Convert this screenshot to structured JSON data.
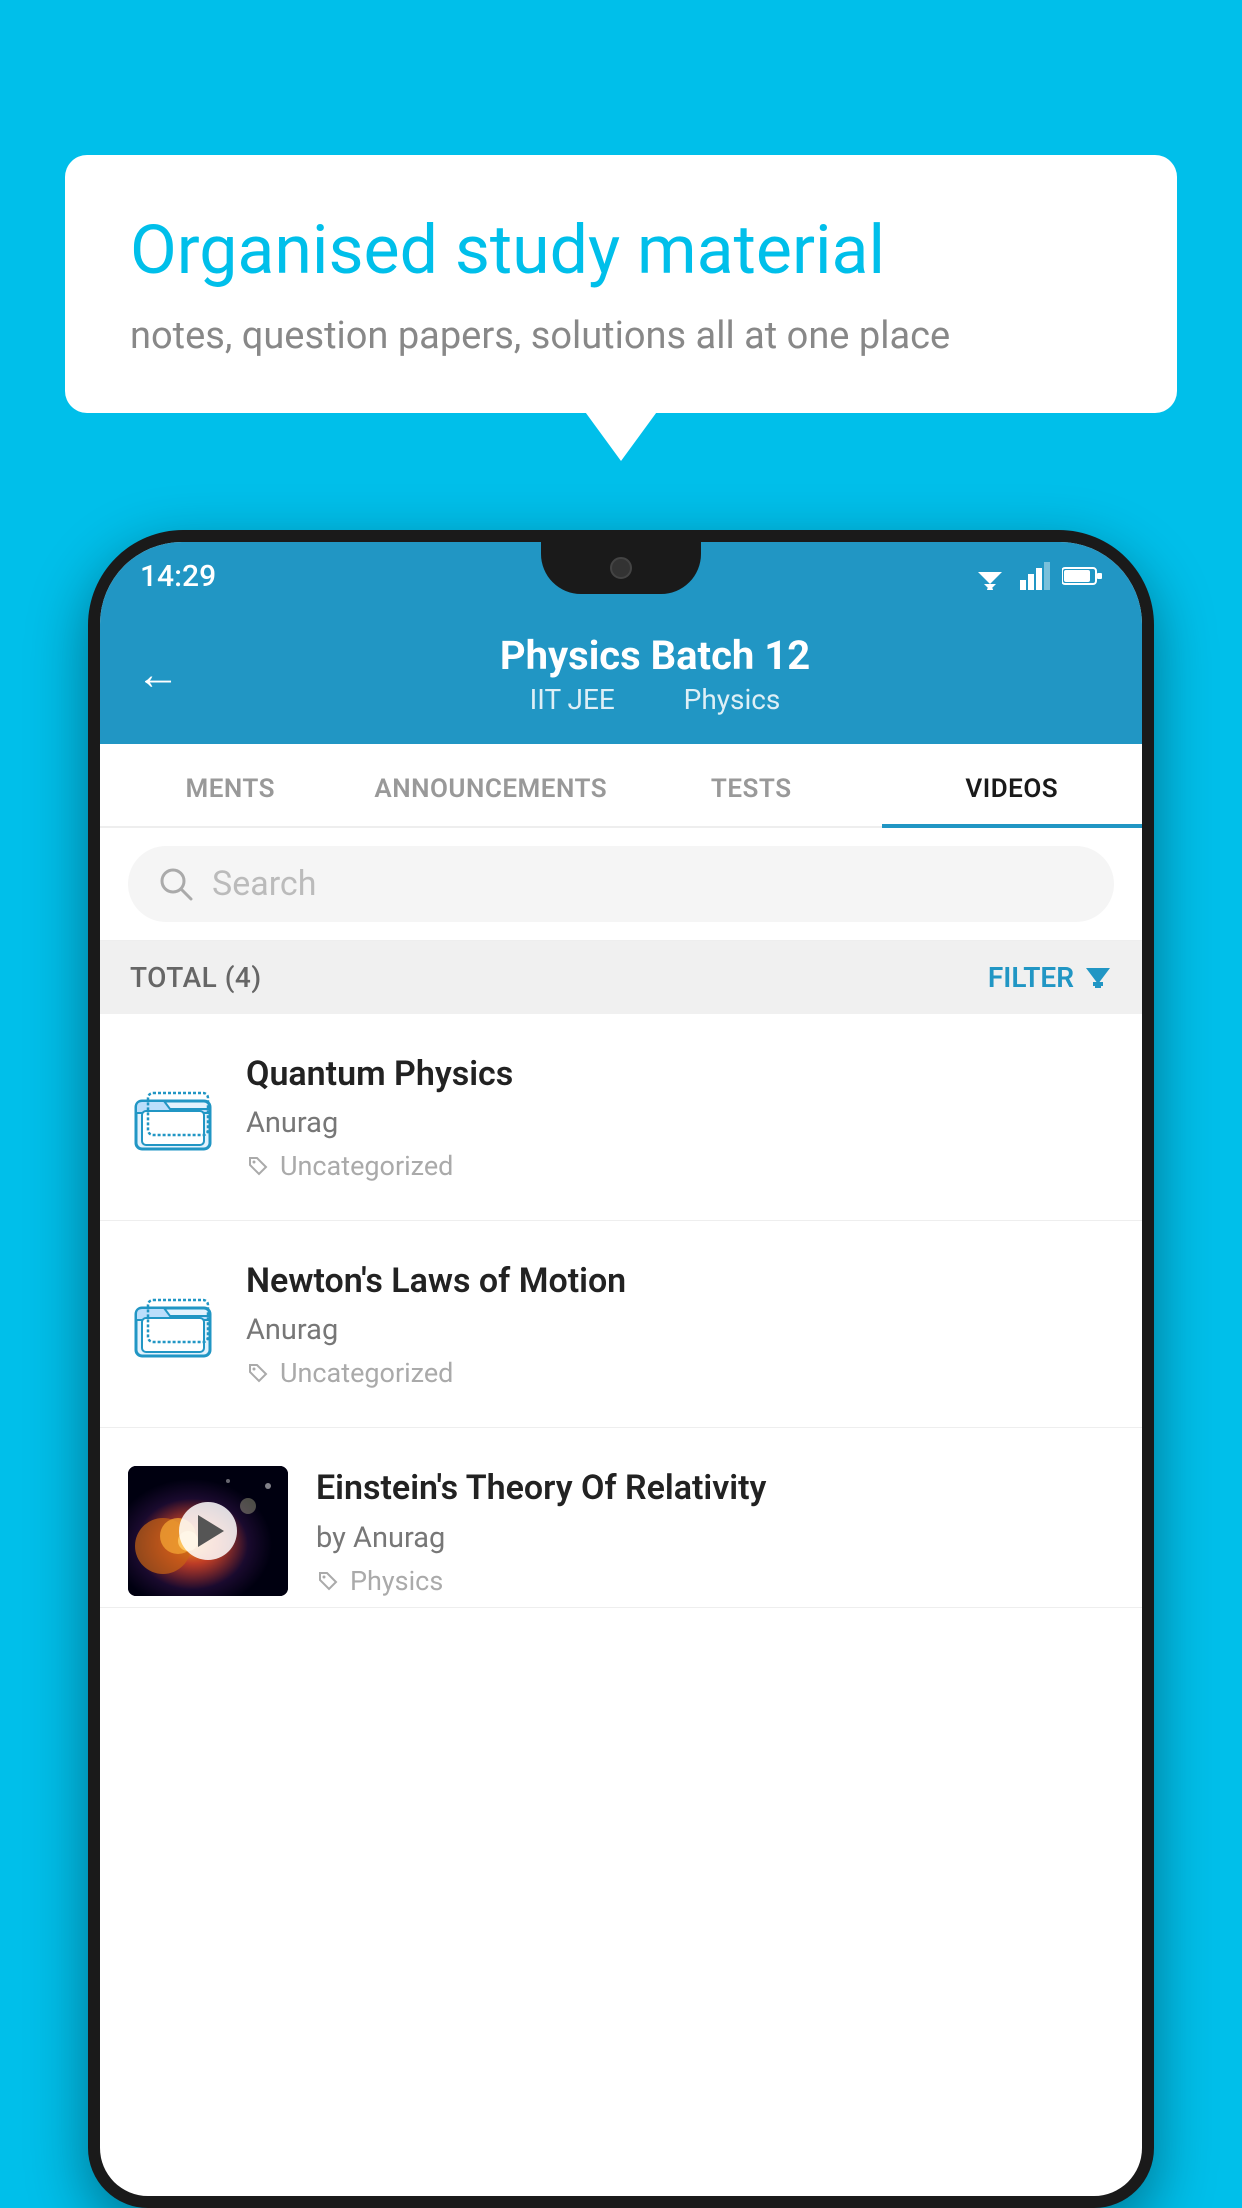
{
  "background_color": "#00BFEA",
  "speech_bubble": {
    "heading": "Organised study material",
    "subtext": "notes, question papers, solutions all at one place"
  },
  "status_bar": {
    "time": "14:29",
    "wifi_icon": "wifi-icon",
    "signal_icon": "signal-icon",
    "battery_icon": "battery-icon"
  },
  "app_bar": {
    "back_icon": "back-arrow-icon",
    "title": "Physics Batch 12",
    "subtitle_batch": "IIT JEE",
    "subtitle_subject": "Physics"
  },
  "tabs": [
    {
      "label": "MENTS",
      "active": false
    },
    {
      "label": "ANNOUNCEMENTS",
      "active": false
    },
    {
      "label": "TESTS",
      "active": false
    },
    {
      "label": "VIDEOS",
      "active": true
    }
  ],
  "search": {
    "placeholder": "Search",
    "icon": "search-icon"
  },
  "filter_bar": {
    "total_label": "TOTAL (4)",
    "filter_label": "FILTER",
    "filter_icon": "filter-icon"
  },
  "video_items": [
    {
      "id": 1,
      "title": "Quantum Physics",
      "author": "Anurag",
      "tag": "Uncategorized",
      "type": "folder",
      "has_thumbnail": false
    },
    {
      "id": 2,
      "title": "Newton's Laws of Motion",
      "author": "Anurag",
      "tag": "Uncategorized",
      "type": "folder",
      "has_thumbnail": false
    },
    {
      "id": 3,
      "title": "Einstein's Theory Of Relativity",
      "author": "by Anurag",
      "tag": "Physics",
      "type": "video",
      "has_thumbnail": true
    }
  ]
}
